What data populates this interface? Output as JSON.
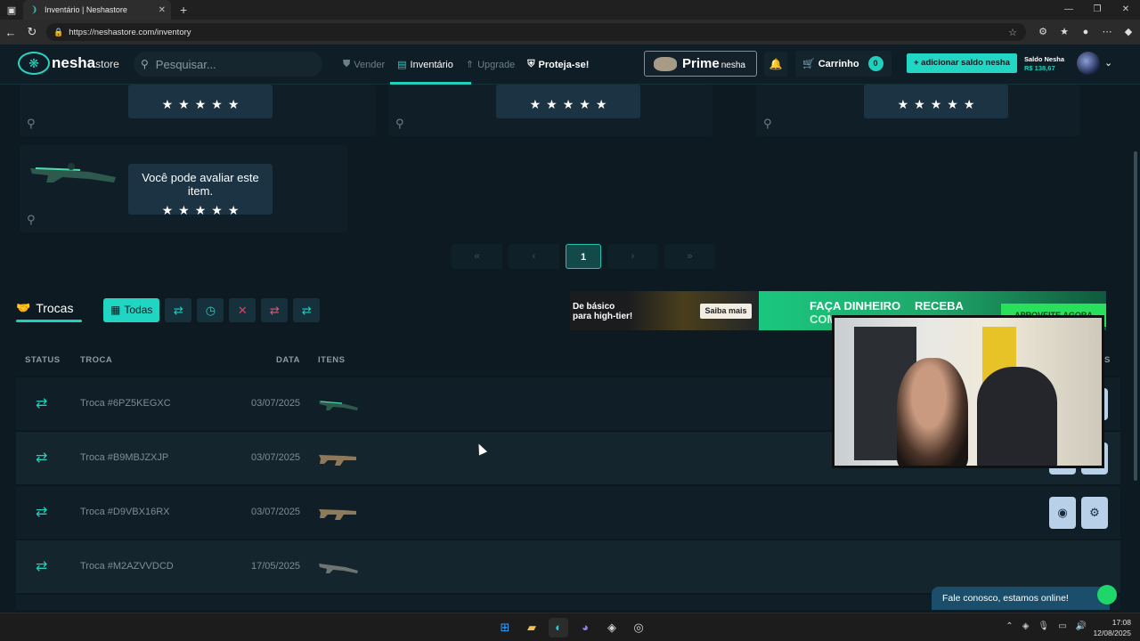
{
  "browser": {
    "tab_title": "Inventário | Neshastore",
    "url": "https://neshastore.com/inventory"
  },
  "header": {
    "logo_name": "nesha",
    "logo_suffix": "store",
    "search_placeholder": "Pesquisar...",
    "nav": [
      {
        "label": "Vender"
      },
      {
        "label": "Inventário"
      },
      {
        "label": "Upgrade"
      },
      {
        "label": "Proteja-se!"
      }
    ],
    "prime_label": "Prime",
    "prime_suffix": "nesha",
    "cart_label": "Carrinho",
    "cart_count": "0",
    "add_balance_label": "+ adicionar saldo nesha",
    "balance_title": "Saldo Nesha",
    "balance_value": "R$ 138,67"
  },
  "inventory": {
    "rate_prompt": "Você pode avaliar este item.",
    "stars": "★★★★★"
  },
  "pagination": {
    "first": "«",
    "prev": "‹",
    "current": "1",
    "next": "›",
    "last": "»"
  },
  "trocas": {
    "title": "Trocas",
    "filter_all": "Todas",
    "columns": {
      "status": "STATUS",
      "troca": "TROCA",
      "data": "DATA",
      "itens": "ITENS",
      "acoes": "S"
    },
    "rows": [
      {
        "id": "Troca #6PZ5KEGXC",
        "date": "03/07/2025",
        "item": "sniper"
      },
      {
        "id": "Troca #B9MBJZXJP",
        "date": "03/07/2025",
        "item": "rifle"
      },
      {
        "id": "Troca #D9VBX16RX",
        "date": "03/07/2025",
        "item": "rifle"
      },
      {
        "id": "Troca #M2AZVVDCD",
        "date": "17/05/2025",
        "item": "sniper"
      }
    ]
  },
  "banners": {
    "b1_line1": "De básico",
    "b1_line2": "para high-tier!",
    "b1_cta": "Saiba mais",
    "b2_line1": "FAÇA DINHEIRO",
    "b2_line2": "COM",
    "b2_line3": "RECEBA",
    "b2_cta": "APROVEITE AGORA"
  },
  "chat": {
    "label": "Fale conosco, estamos online!"
  },
  "taskbar": {
    "time": "17:08",
    "date": "12/08/2025"
  },
  "colors": {
    "accent": "#1fd0bd",
    "bg": "#0d1a22"
  }
}
